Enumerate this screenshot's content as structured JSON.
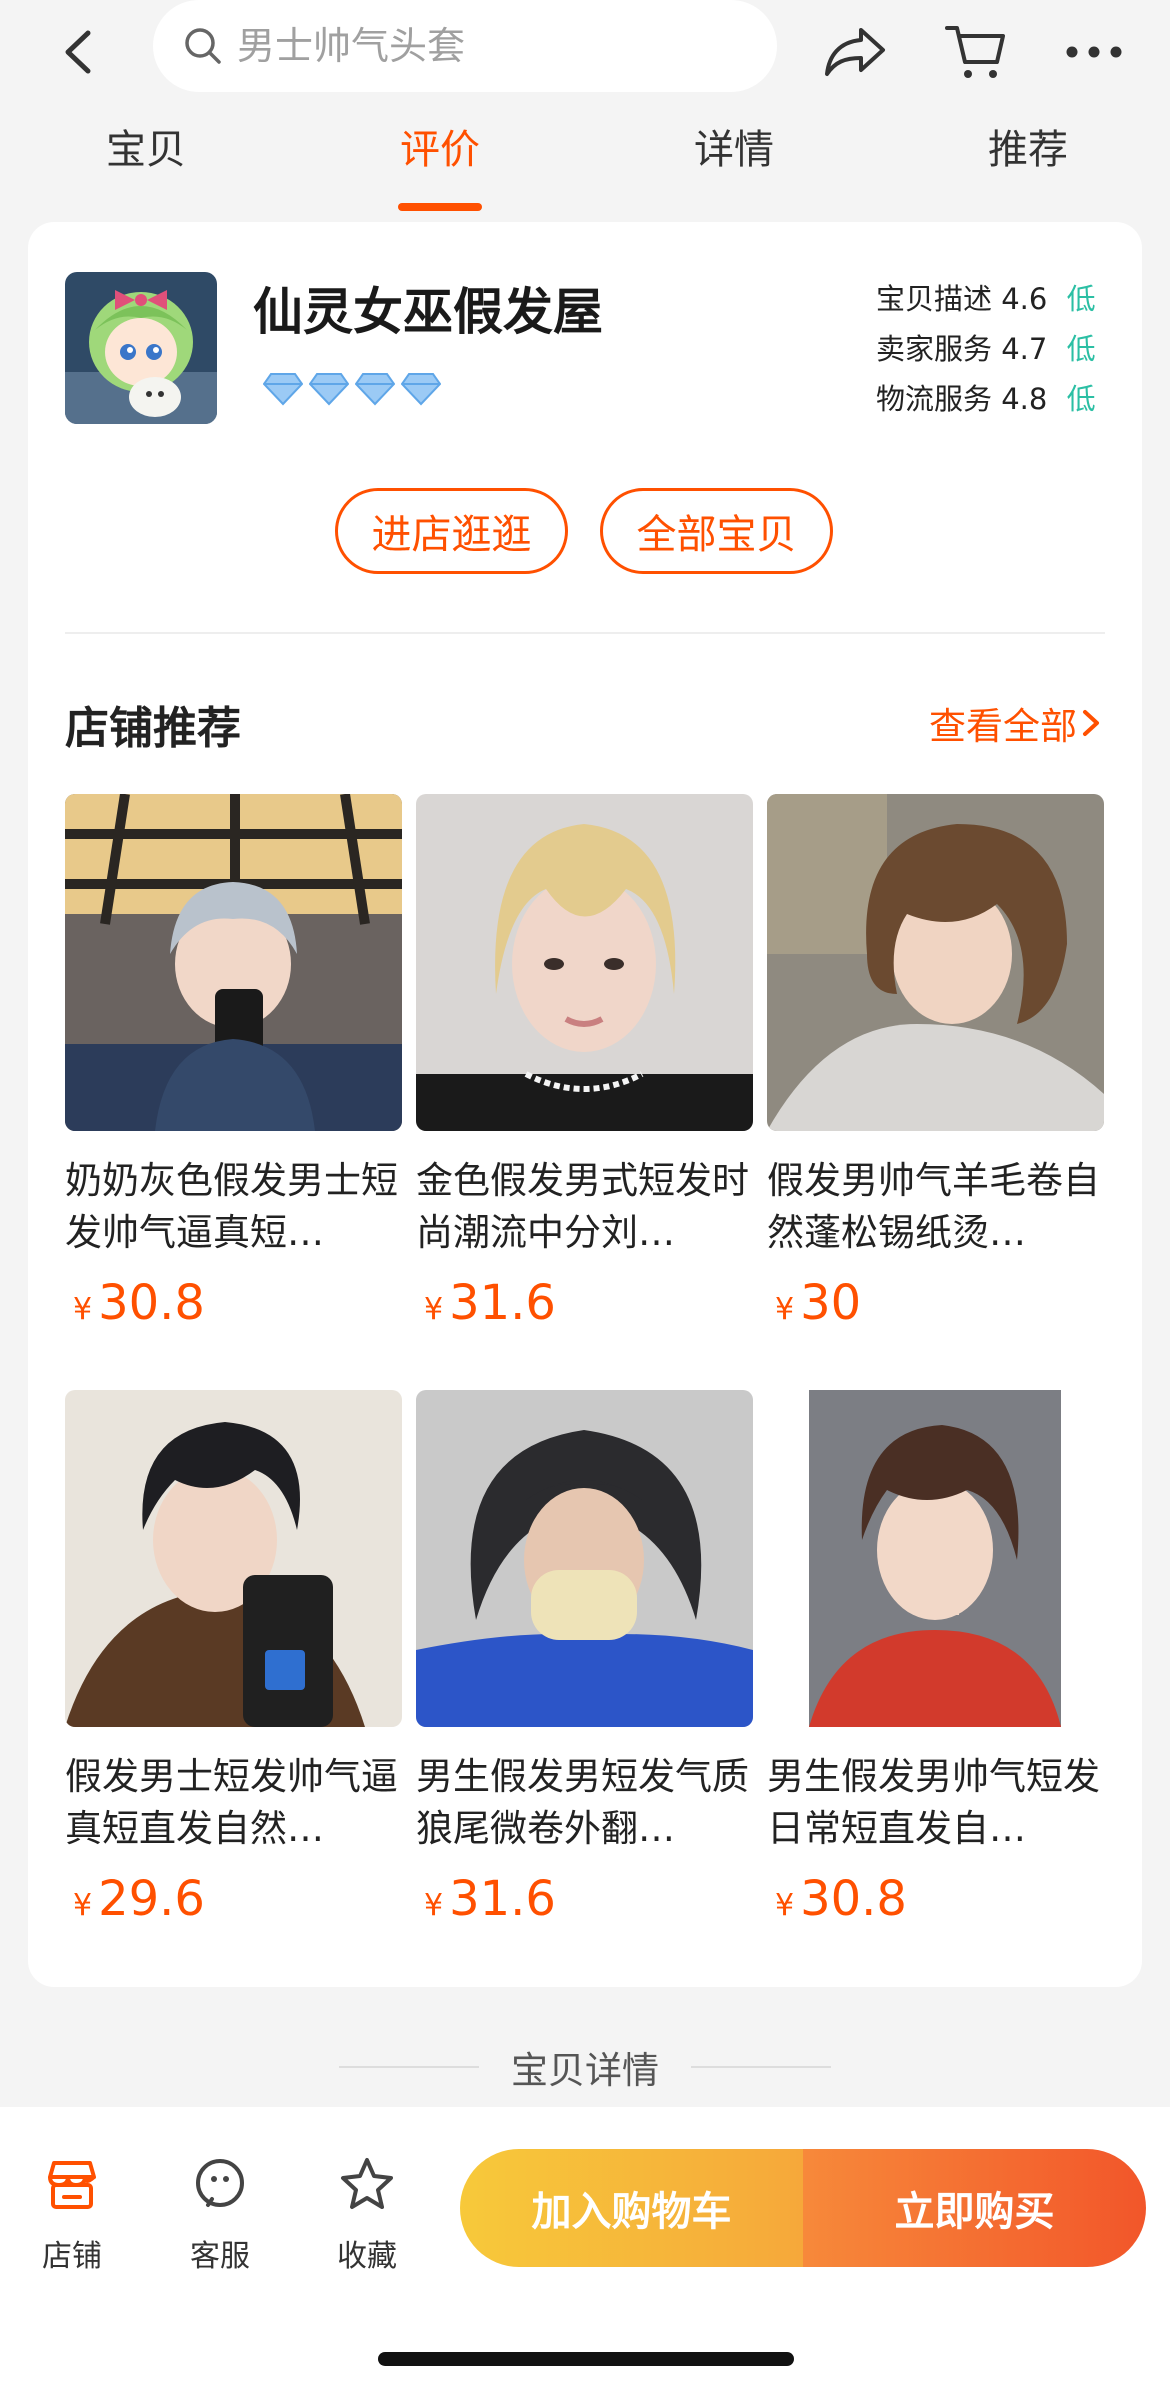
{
  "header": {
    "search_placeholder": "男士帅气头套",
    "tabs": [
      {
        "label": "宝贝",
        "active": false
      },
      {
        "label": "评价",
        "active": true
      },
      {
        "label": "详情",
        "active": false
      },
      {
        "label": "推荐",
        "active": false
      }
    ],
    "icons": [
      "back-arrow-icon",
      "share-icon",
      "cart-icon",
      "more-icon"
    ]
  },
  "shop": {
    "name": "仙灵女巫假发屋",
    "diamond_count": 4,
    "ratings": [
      {
        "label": "宝贝描述",
        "score": "4.6",
        "level": "低"
      },
      {
        "label": "卖家服务",
        "score": "4.7",
        "level": "低"
      },
      {
        "label": "物流服务",
        "score": "4.8",
        "level": "低"
      }
    ],
    "enter_store_label": "进店逛逛",
    "all_items_label": "全部宝贝"
  },
  "recommend": {
    "title": "店铺推荐",
    "view_all_label": "查看全部",
    "items": [
      {
        "title": "奶奶灰色假发男士短发帅气逼真短…",
        "currency": "¥",
        "price": "30.8",
        "hair": "#b9c2cc"
      },
      {
        "title": "金色假发男式短发时尚潮流中分刘…",
        "currency": "¥",
        "price": "31.6",
        "hair": "#e3cb8e"
      },
      {
        "title": "假发男帅气羊毛卷自然蓬松锡纸烫…",
        "currency": "¥",
        "price": "30",
        "hair": "#6b4a30"
      },
      {
        "title": "假发男士短发帅气逼真短直发自然…",
        "currency": "¥",
        "price": "29.6",
        "hair": "#1e1e22"
      },
      {
        "title": "男生假发男短发气质狼尾微卷外翻…",
        "currency": "¥",
        "price": "31.6",
        "hair": "#2b2b2e"
      },
      {
        "title": "男生假发男帅气短发日常短直发自…",
        "currency": "¥",
        "price": "30.8",
        "hair": "#4a2f24"
      }
    ]
  },
  "detail_divider": "宝贝详情",
  "bottom_bar": {
    "store_label": "店铺",
    "service_label": "客服",
    "favorite_label": "收藏",
    "add_cart_label": "加入购物车",
    "buy_now_label": "立即购买"
  },
  "colors": {
    "accent": "#ff5000",
    "low_rating": "#2bbfa4"
  }
}
